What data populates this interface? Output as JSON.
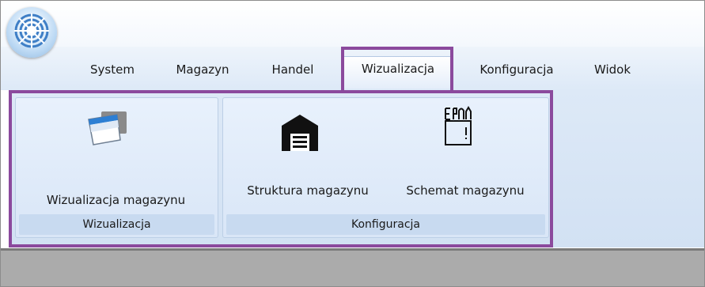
{
  "app": {
    "orb_icon": "app-orb-icon"
  },
  "tabs": [
    {
      "label": "System"
    },
    {
      "label": "Magazyn"
    },
    {
      "label": "Handel"
    },
    {
      "label": "Wizualizacja"
    },
    {
      "label": "Konfiguracja"
    },
    {
      "label": "Widok"
    }
  ],
  "active_tab": "Wizualizacja",
  "groups": {
    "wizualizacja": {
      "label": "Wizualizacja",
      "buttons": [
        {
          "label": "Wizualizacja magazynu",
          "icon": "window-icon"
        }
      ]
    },
    "konfiguracja": {
      "label": "Konfiguracja",
      "buttons": [
        {
          "label": "Struktura magazynu",
          "icon": "warehouse-icon"
        },
        {
          "label": "Schemat magazynu",
          "icon": "schema-tools-icon"
        }
      ]
    }
  },
  "colors": {
    "highlight": "#8b4a9d",
    "ribbon": "#dde9f7",
    "status_area": "#ababab"
  }
}
